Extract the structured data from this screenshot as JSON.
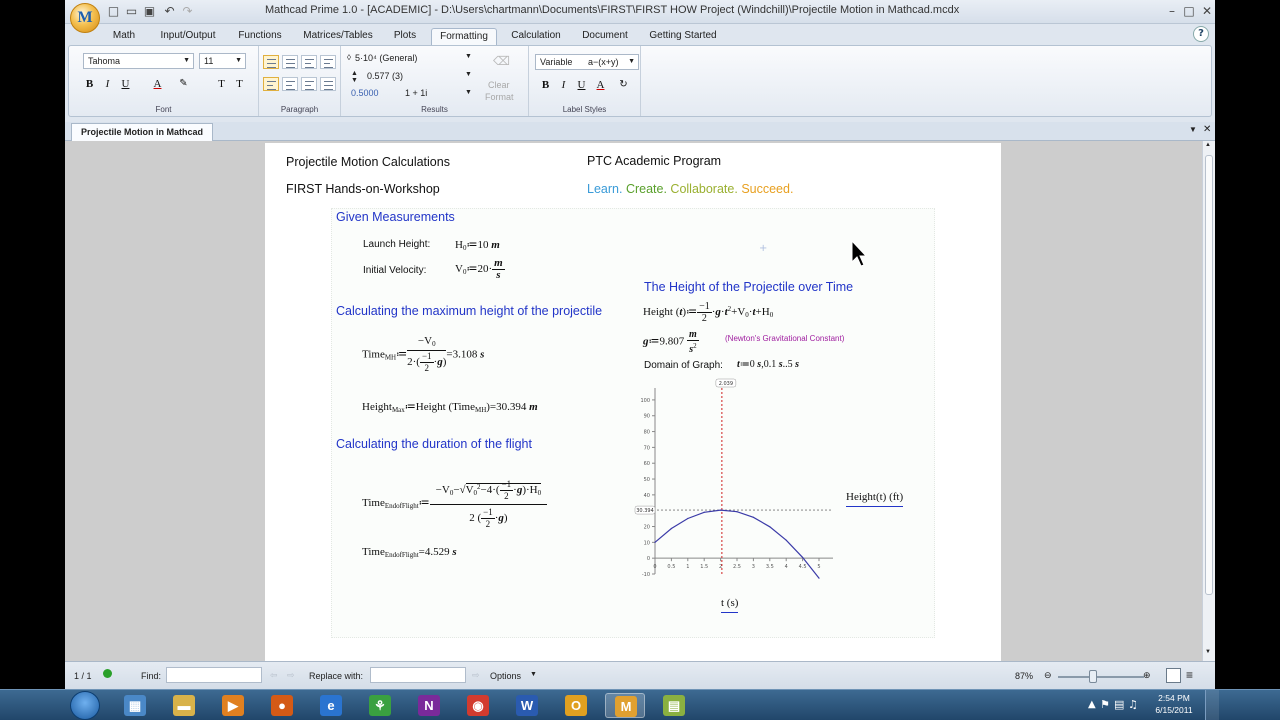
{
  "window": {
    "logo": "M",
    "title": "Mathcad Prime 1.0 - [ACADEMIC] - D:\\Users\\chartmann\\Documents\\FIRST\\FIRST HOW Project (Windchill)\\Projectile Motion in Mathcad.mcdx",
    "minimize": "–",
    "maximize": "□",
    "close": "✕"
  },
  "ribbon": {
    "tabs": [
      {
        "label": "Math"
      },
      {
        "label": "Input/Output"
      },
      {
        "label": "Functions"
      },
      {
        "label": "Matrices/Tables"
      },
      {
        "label": "Plots"
      },
      {
        "label": "Formatting"
      },
      {
        "label": "Calculation"
      },
      {
        "label": "Document"
      },
      {
        "label": "Getting Started"
      }
    ],
    "active_tab": "Formatting",
    "help": "?",
    "font": {
      "family": "Tahoma",
      "size": "11",
      "group_label": "Font"
    },
    "paragraph": {
      "group_label": "Paragraph"
    },
    "results": {
      "format_value": "5·10⁴ (General)",
      "precision_value": "0.577 (3)",
      "zeros_value": "0.5000",
      "complex_value": "1 + 1i",
      "group_label": "Results"
    },
    "clear_format": {
      "line1": "Clear",
      "line2": "Format"
    },
    "label_styles": {
      "variable": "Variable",
      "preview": "a−(x+y)",
      "group_label": "Label Styles"
    },
    "format_buttons": {
      "bold": "B",
      "italic": "I",
      "underline": "U",
      "font_color": "A",
      "superscript": "T",
      "subscript": "T"
    }
  },
  "document": {
    "tab_label": "Projectile Motion in Mathcad",
    "header_left_1": "Projectile Motion Calculations",
    "header_left_2": "FIRST Hands-on-Workshop",
    "header_right_1": "PTC Academic Program",
    "tagline": {
      "learn": "Learn.",
      "create": "Create.",
      "collaborate": "Collaborate.",
      "succeed": "Succeed."
    },
    "given_heading": "Given Measurements",
    "launch_height_label": "Launch Height:",
    "initial_velocity_label": "Initial Velocity:",
    "max_height_heading": "Calculating the maximum height of the projectile",
    "duration_heading": "Calculating the duration of the flight",
    "height_over_time_heading": "The Height of the Projectile over Time",
    "gravity_note": "(Newton's Gravitational Constant)",
    "domain_label": "Domain of Graph:",
    "values": {
      "H0": "10",
      "V0": "20",
      "g": "9.807",
      "time_mh": "3.108",
      "height_max": "30.394",
      "time_end_of_flight": "4.529"
    },
    "domain": {
      "start": "0",
      "step": "0.1",
      "end": "5"
    }
  },
  "chart_data": {
    "type": "line",
    "series": [
      {
        "function": "Height(t) = -1/2*g*t^2 + V0*t + H0",
        "x": [
          0,
          0.5,
          1.0,
          1.5,
          2.0,
          2.5,
          3.0,
          3.5,
          4.0,
          4.5,
          5.0
        ],
        "y": [
          10,
          18.77,
          25.1,
          29.0,
          30.39,
          29.35,
          25.81,
          19.83,
          11.37,
          0.46,
          -12.59
        ]
      }
    ],
    "xlabel": "t (s)",
    "ylabel": "Height(t) (ft)",
    "x_ticks": [
      "0",
      "0.5",
      "1",
      "1.5",
      "2",
      "2.5",
      "3",
      "3.5",
      "4",
      "4.5",
      "5"
    ],
    "y_ticks": [
      "100",
      "90",
      "80",
      "70",
      "60",
      "50",
      "40",
      "30",
      "20",
      "10",
      "0",
      "-10"
    ],
    "xlim": [
      0,
      5
    ],
    "ylim": [
      -10,
      105
    ],
    "marker_x": "2.039",
    "marker_y": "30.394",
    "color": "#3b3ba8",
    "marker_color": "#d02020"
  },
  "statusbar": {
    "page": "1 / 1",
    "find_label": "Find:",
    "replace_label": "Replace with:",
    "options_label": "Options",
    "zoom": "87%"
  },
  "taskbar": {
    "time": "2:54 PM",
    "date": "6/15/2011",
    "apps": [
      {
        "icon": "explorer-icon",
        "glyph": "▦",
        "color": "#4a88c7"
      },
      {
        "icon": "folder-icon",
        "glyph": "▬",
        "color": "#d8b24a"
      },
      {
        "icon": "media-player-icon",
        "glyph": "▶",
        "color": "#e08020"
      },
      {
        "icon": "firefox-icon",
        "glyph": "●",
        "color": "#d45a16"
      },
      {
        "icon": "internet-explorer-icon",
        "glyph": "e",
        "color": "#2a74d0"
      },
      {
        "icon": "app-green-icon",
        "glyph": "⚘",
        "color": "#3aa040"
      },
      {
        "icon": "onenote-icon",
        "glyph": "N",
        "color": "#7a2a9a"
      },
      {
        "icon": "chrome-icon",
        "glyph": "◉",
        "color": "#d23b2f"
      },
      {
        "icon": "word-icon",
        "glyph": "W",
        "color": "#2a5bb0"
      },
      {
        "icon": "outlook-icon",
        "glyph": "O",
        "color": "#e0a020"
      },
      {
        "icon": "mathcad-icon",
        "glyph": "M",
        "color": "#e0a030"
      },
      {
        "icon": "notes-icon",
        "glyph": "▤",
        "color": "#8ab040"
      }
    ]
  }
}
